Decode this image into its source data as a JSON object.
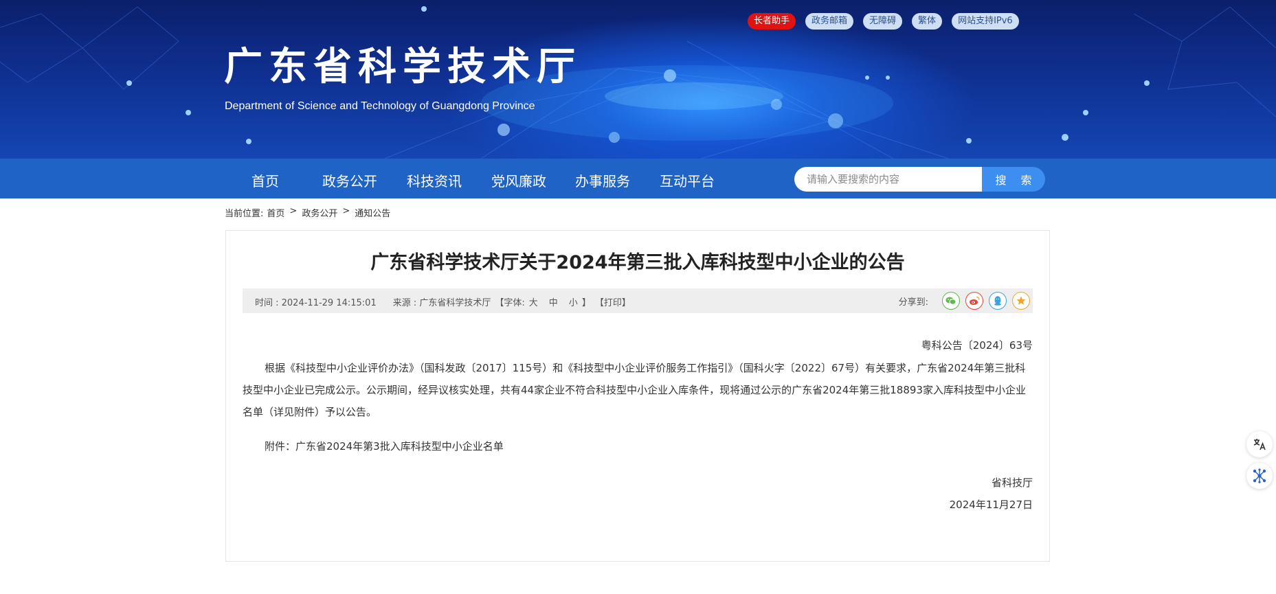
{
  "header": {
    "site_title": "广东省科学技术厅",
    "site_subtitle": "Department of Science and Technology of Guangdong Province",
    "top_links": [
      "长者助手",
      "政务邮箱",
      "无障碍",
      "繁体",
      "网站支持IPv6"
    ]
  },
  "nav": {
    "items": [
      "首页",
      "政务公开",
      "科技资讯",
      "党风廉政",
      "办事服务",
      "互动平台"
    ],
    "search_placeholder": "请输入要搜索的内容",
    "search_button": "搜 索"
  },
  "breadcrumb": {
    "label": "当前位置:",
    "items": [
      "首页",
      "政务公开",
      "通知公告"
    ],
    "separator": ">"
  },
  "article": {
    "title": "广东省科学技术厅关于2024年第三批入库科技型中小企业的公告",
    "meta": {
      "time": "时间 : 2024-11-29 14:15:01",
      "source": "来源 : 广东省科学技术厅",
      "font_label": "【字体:",
      "font_sizes": [
        "大",
        "中",
        "小"
      ],
      "font_close": "】",
      "print": "【打印】",
      "share_label": "分享到:"
    },
    "doc_number": "粤科公告〔2024〕63号",
    "paragraph": "根据《科技型中小企业评价办法》（国科发政〔2017〕115号）和《科技型中小企业评价服务工作指引》（国科火字〔2022〕67号）有关要求，广东省2024年第三批科技型中小企业已完成公示。公示期间，经异议核实处理，共有44家企业不符合科技型中小企业入库条件，现将通过公示的广东省2024年第三批18893家入库科技型中小企业名单（详见附件）予以公告。",
    "attachment": "附件：广东省2024年第3批入库科技型中小企业名单",
    "signature": "省科技厅",
    "date": "2024年11月27日"
  },
  "colors": {
    "nav_bg": "#1f63c6",
    "banner_dark": "#0b1f6b",
    "search_button": "#3c8ef0",
    "elder_helper": "#e01212"
  }
}
